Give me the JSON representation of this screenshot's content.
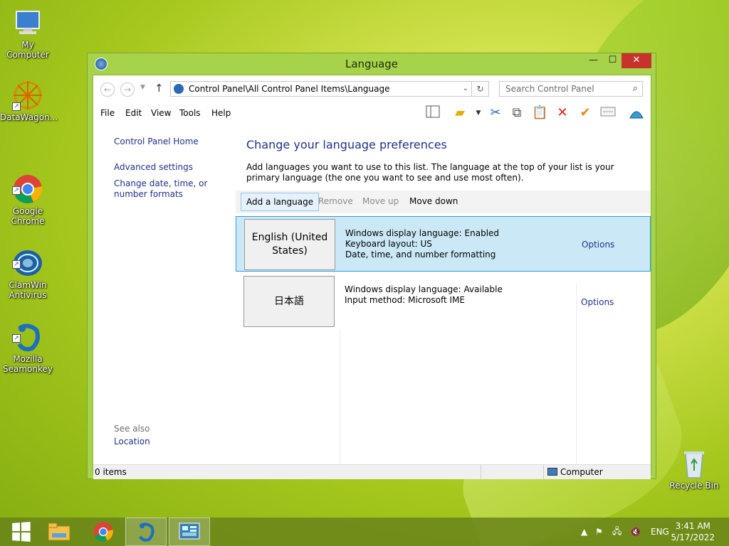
{
  "desktop": {
    "icons": [
      {
        "label": "My Computer"
      },
      {
        "label": "DataWagon..."
      },
      {
        "label": "Google\nChrome"
      },
      {
        "label": "ClamWin\nAntivirus"
      },
      {
        "label": "Mozilla\nSeamonkey"
      },
      {
        "label": "Recycle Bin"
      }
    ]
  },
  "window": {
    "title": "Language",
    "controls": {
      "minimize": "—",
      "maximize": "☐",
      "close": "✕"
    },
    "address": {
      "path": "Control Panel\\All Control Panel Items\\Language",
      "search_placeholder": "Search Control Panel"
    },
    "menu": [
      "File",
      "Edit",
      "View",
      "Tools",
      "Help"
    ],
    "left_pane": {
      "home": "Control Panel Home",
      "advanced": "Advanced settings",
      "change_date": "Change date, time, or number formats",
      "see_also": "See also",
      "location": "Location"
    },
    "main": {
      "heading": "Change your language preferences",
      "description": "Add languages you want to use to this list. The language at the top of your list is your primary language (the one you want to see and use most often).",
      "commands": {
        "add": "Add a language",
        "remove": "Remove",
        "move_up": "Move up",
        "move_down": "Move down"
      },
      "languages": [
        {
          "name": "English (United States)",
          "info": [
            "Windows display language: Enabled",
            "Keyboard layout: US",
            "Date, time, and number formatting"
          ],
          "options": "Options",
          "selected": true
        },
        {
          "name": "日本語",
          "info": [
            "Windows display language: Available",
            "Input method: Microsoft IME"
          ],
          "options": "Options",
          "selected": false
        }
      ]
    },
    "status": {
      "items": "0 items",
      "computer": "Computer"
    }
  },
  "taskbar": {
    "lang": "ENG",
    "time": "3:41 AM",
    "date": "5/17/2022"
  }
}
